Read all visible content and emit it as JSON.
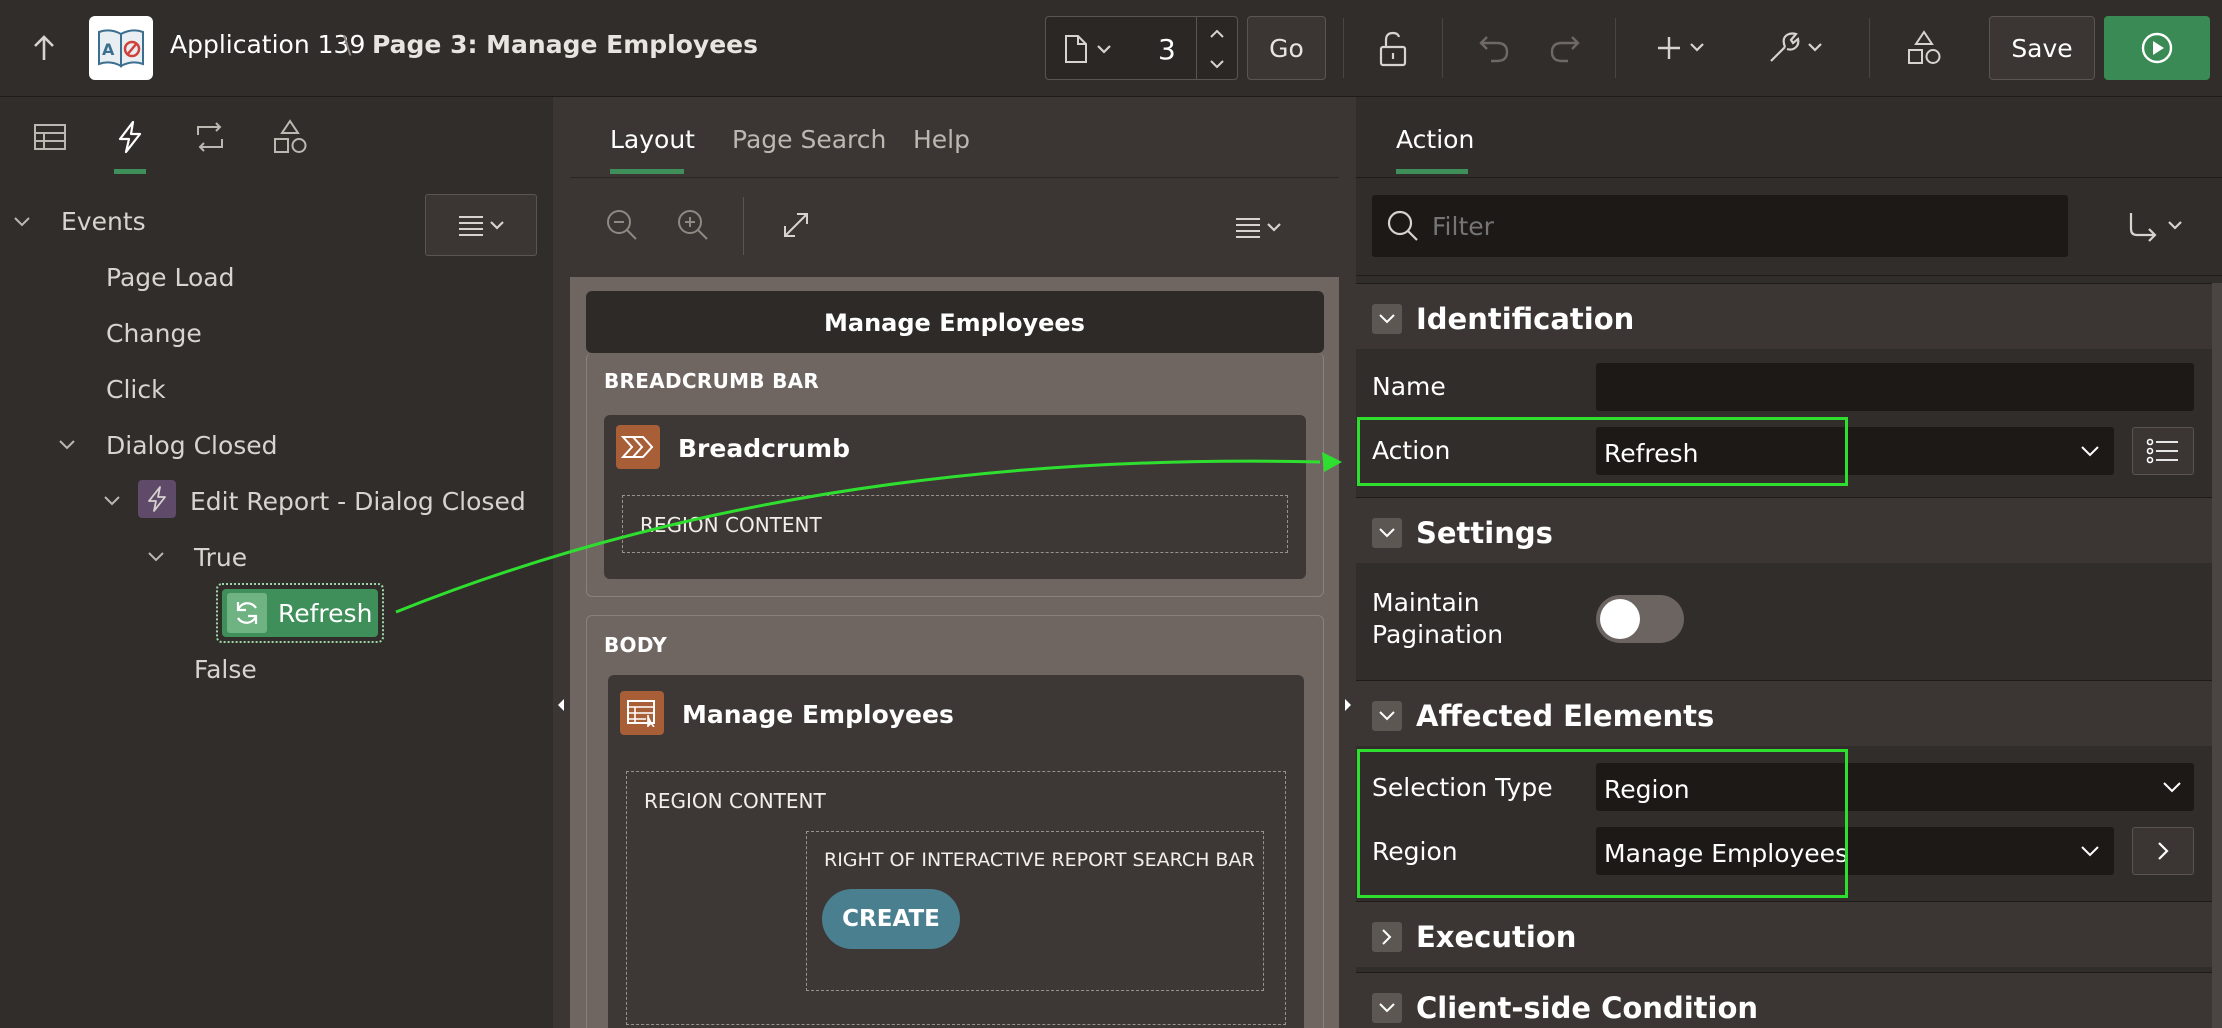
{
  "header": {
    "app_name": "Application 139",
    "separator": "\\",
    "page_title": "Page 3: Manage Employees",
    "page_number": "3",
    "go_label": "Go",
    "save_label": "Save"
  },
  "left_panel": {
    "tree": {
      "events": "Events",
      "page_load": "Page Load",
      "change": "Change",
      "click": "Click",
      "dialog_closed": "Dialog Closed",
      "edit_report": "Edit Report - Dialog Closed",
      "true_branch": "True",
      "refresh_action": "Refresh",
      "false_branch": "False"
    }
  },
  "middle_panel": {
    "tabs": [
      "Layout",
      "Page Search",
      "Help"
    ],
    "page_header": "Manage Employees",
    "breadcrumb_bar": "BREADCRUMB BAR",
    "breadcrumb_region": "Breadcrumb",
    "region_content_1": "REGION CONTENT",
    "body_label": "BODY",
    "report_region": "Manage Employees",
    "region_content_2": "REGION CONTENT",
    "right_of_search": "RIGHT OF INTERACTIVE REPORT SEARCH BAR",
    "create_button": "CREATE"
  },
  "right_panel": {
    "tab": "Action",
    "filter_placeholder": "Filter",
    "sections": {
      "identification": "Identification",
      "settings": "Settings",
      "affected_elements": "Affected Elements",
      "execution": "Execution",
      "client_side_condition": "Client-side Condition"
    },
    "fields": {
      "name_label": "Name",
      "name_value": "",
      "action_label": "Action",
      "action_value": "Refresh",
      "maintain_pagination_label": "Maintain Pagination",
      "maintain_pagination_on": false,
      "selection_type_label": "Selection Type",
      "selection_type_value": "Region",
      "region_label": "Region",
      "region_value": "Manage Employees"
    }
  },
  "colors": {
    "highlight": "#2fdf2f",
    "run_button": "#3a8a55",
    "refresh_badge": "#3f8f5a",
    "event_badge": "#5f4a6a",
    "region_icon": "#a85f37",
    "create_button": "#4a7f90"
  }
}
